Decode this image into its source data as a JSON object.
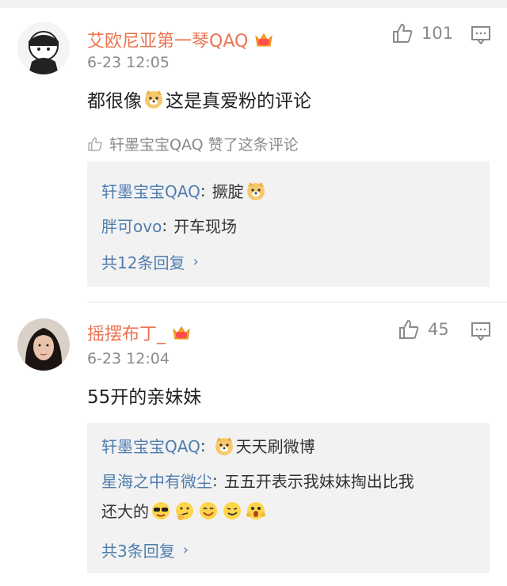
{
  "comments": [
    {
      "username": "艾欧尼亚第一琴QAQ",
      "time": "6-23 12:05",
      "likes": "101",
      "content_text": "都很像",
      "content_emoji": "doge-emoji",
      "content_text2": "这是真爱粉的评论",
      "liked_by_name": "轩墨宝宝QAQ",
      "liked_by_action": "赞了这条评论",
      "replies": [
        {
          "name": "轩墨宝宝QAQ",
          "sep": ":",
          "text": "撅腚",
          "emoji": "doge-emoji"
        },
        {
          "name": "胖可ovo",
          "sep": ":",
          "text": "开车现场"
        }
      ],
      "more": "共12条回复"
    },
    {
      "username": "摇摆布丁_",
      "time": "6-23 12:04",
      "likes": "45",
      "content_text": "55开的亲妹妹",
      "replies": [
        {
          "name": "轩墨宝宝QAQ",
          "sep": ":",
          "text": "天天刷微博",
          "emoji": "doge-emoji"
        },
        {
          "name": "星海之中有微尘",
          "sep": ":",
          "text": "五五开表示我妹妹掏出比我",
          "text2": "还大的",
          "emojis": [
            "cool-emoji",
            "thinking-emoji",
            "smile-emoji",
            "smirk-emoji",
            "shocked-emoji"
          ]
        }
      ],
      "more": "共3条回复"
    }
  ],
  "icons": {
    "like": "thumbs-up-icon",
    "reply": "comment-icon",
    "vip": "crown-badge-icon",
    "chevron": "chevron-right-icon"
  },
  "colors": {
    "username": "#eb7350",
    "link": "#507daf",
    "meta": "#8a8a8a",
    "reply_bg": "#f2f2f2"
  }
}
